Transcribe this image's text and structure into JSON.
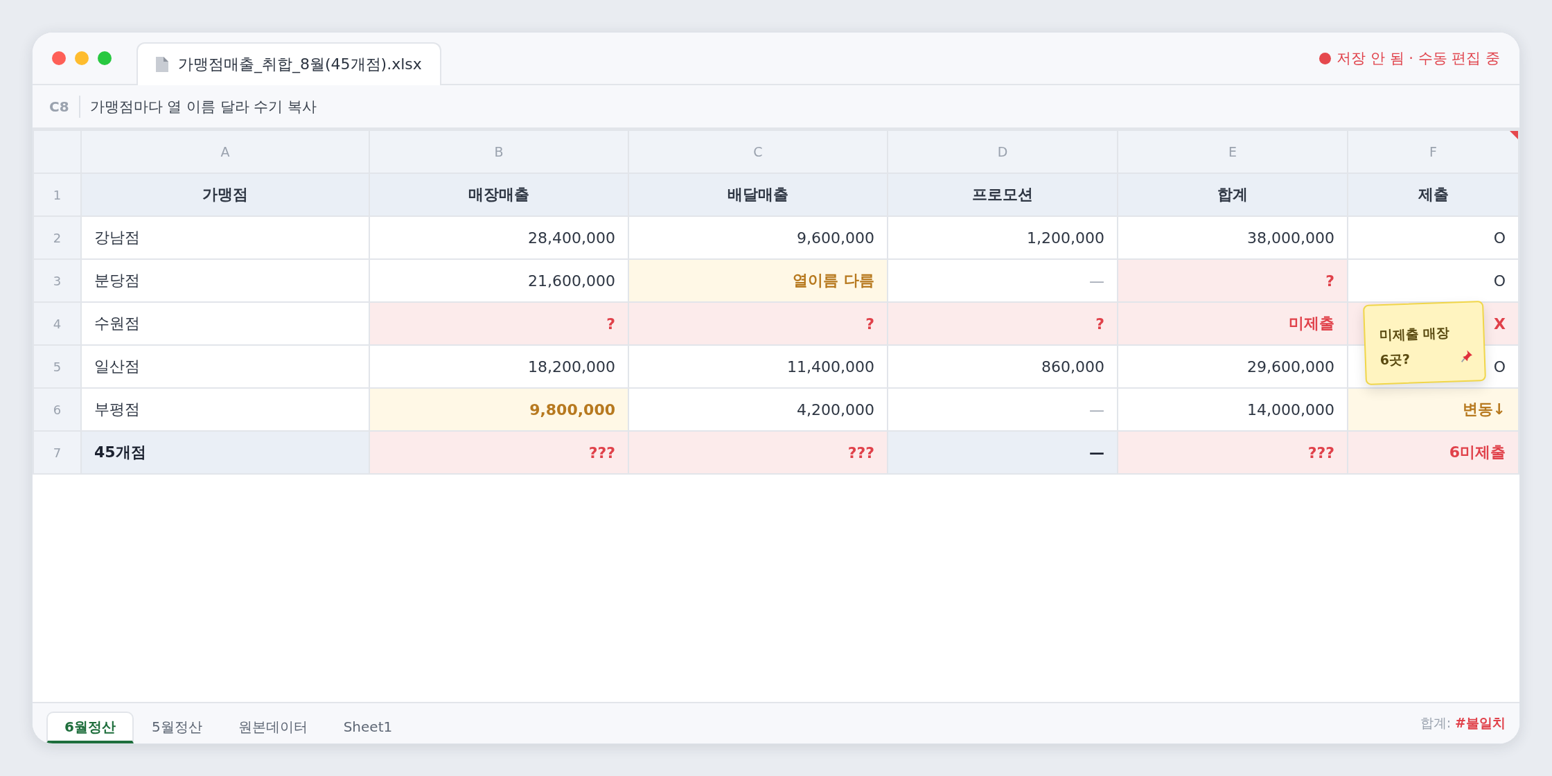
{
  "window": {
    "file_name": "가맹점매출_취합_8월(45개점).xlsx",
    "status": "저장 안 됨 · 수동 편집 중"
  },
  "formula_bar": {
    "cell_ref": "C8",
    "content": "가맹점마다 열 이름 달라 수기 복사"
  },
  "columns": [
    "A",
    "B",
    "C",
    "D",
    "E",
    "F"
  ],
  "rows": [
    {
      "number": "1",
      "kind": "header",
      "cells": [
        {
          "text": "가맹점",
          "kind": "plain"
        },
        {
          "text": "매장매출",
          "kind": "plain"
        },
        {
          "text": "배달매출",
          "kind": "plain"
        },
        {
          "text": "프로모션",
          "kind": "plain"
        },
        {
          "text": "합계",
          "kind": "plain"
        },
        {
          "text": "제출",
          "kind": "plain"
        }
      ]
    },
    {
      "number": "2",
      "kind": "data",
      "cells": [
        {
          "text": "강남점",
          "kind": "plain"
        },
        {
          "text": "28,400,000",
          "kind": "plain"
        },
        {
          "text": "9,600,000",
          "kind": "plain"
        },
        {
          "text": "1,200,000",
          "kind": "plain"
        },
        {
          "text": "38,000,000",
          "kind": "plain"
        },
        {
          "text": "O",
          "kind": "plain"
        }
      ]
    },
    {
      "number": "3",
      "kind": "data",
      "cells": [
        {
          "text": "분당점",
          "kind": "plain"
        },
        {
          "text": "21,600,000",
          "kind": "plain"
        },
        {
          "text": "열이름 다름",
          "kind": "warn"
        },
        {
          "text": "—",
          "kind": "muted"
        },
        {
          "text": "?",
          "kind": "error"
        },
        {
          "text": "O",
          "kind": "plain"
        }
      ]
    },
    {
      "number": "4",
      "kind": "data",
      "cells": [
        {
          "text": "수원점",
          "kind": "plain"
        },
        {
          "text": "?",
          "kind": "error"
        },
        {
          "text": "?",
          "kind": "error"
        },
        {
          "text": "?",
          "kind": "error"
        },
        {
          "text": "미제출",
          "kind": "error"
        },
        {
          "text": "X",
          "kind": "error"
        }
      ]
    },
    {
      "number": "5",
      "kind": "data",
      "cells": [
        {
          "text": "일산점",
          "kind": "plain"
        },
        {
          "text": "18,200,000",
          "kind": "plain"
        },
        {
          "text": "11,400,000",
          "kind": "plain"
        },
        {
          "text": "860,000",
          "kind": "plain"
        },
        {
          "text": "29,600,000",
          "kind": "plain"
        },
        {
          "text": "O",
          "kind": "plain"
        }
      ]
    },
    {
      "number": "6",
      "kind": "data",
      "cells": [
        {
          "text": "부평점",
          "kind": "plain"
        },
        {
          "text": "9,800,000",
          "kind": "warn"
        },
        {
          "text": "4,200,000",
          "kind": "plain"
        },
        {
          "text": "—",
          "kind": "muted"
        },
        {
          "text": "14,000,000",
          "kind": "plain"
        },
        {
          "text": "변동↓",
          "kind": "warn"
        }
      ]
    },
    {
      "number": "7",
      "kind": "total",
      "cells": [
        {
          "text": "45개점",
          "kind": "plain"
        },
        {
          "text": "???",
          "kind": "error"
        },
        {
          "text": "???",
          "kind": "error"
        },
        {
          "text": "—",
          "kind": "plain"
        },
        {
          "text": "???",
          "kind": "error"
        },
        {
          "text": "6미제출",
          "kind": "error"
        }
      ]
    }
  ],
  "sticky_note": {
    "text": "미제출 매장 6곳?"
  },
  "sheet_tabs": [
    {
      "label": "6월정산",
      "selected": true
    },
    {
      "label": "5월정산",
      "selected": false
    },
    {
      "label": "원본데이터",
      "selected": false
    },
    {
      "label": "Sheet1",
      "selected": false
    }
  ],
  "status_bar": {
    "label": "합계:",
    "value": "#불일치"
  }
}
